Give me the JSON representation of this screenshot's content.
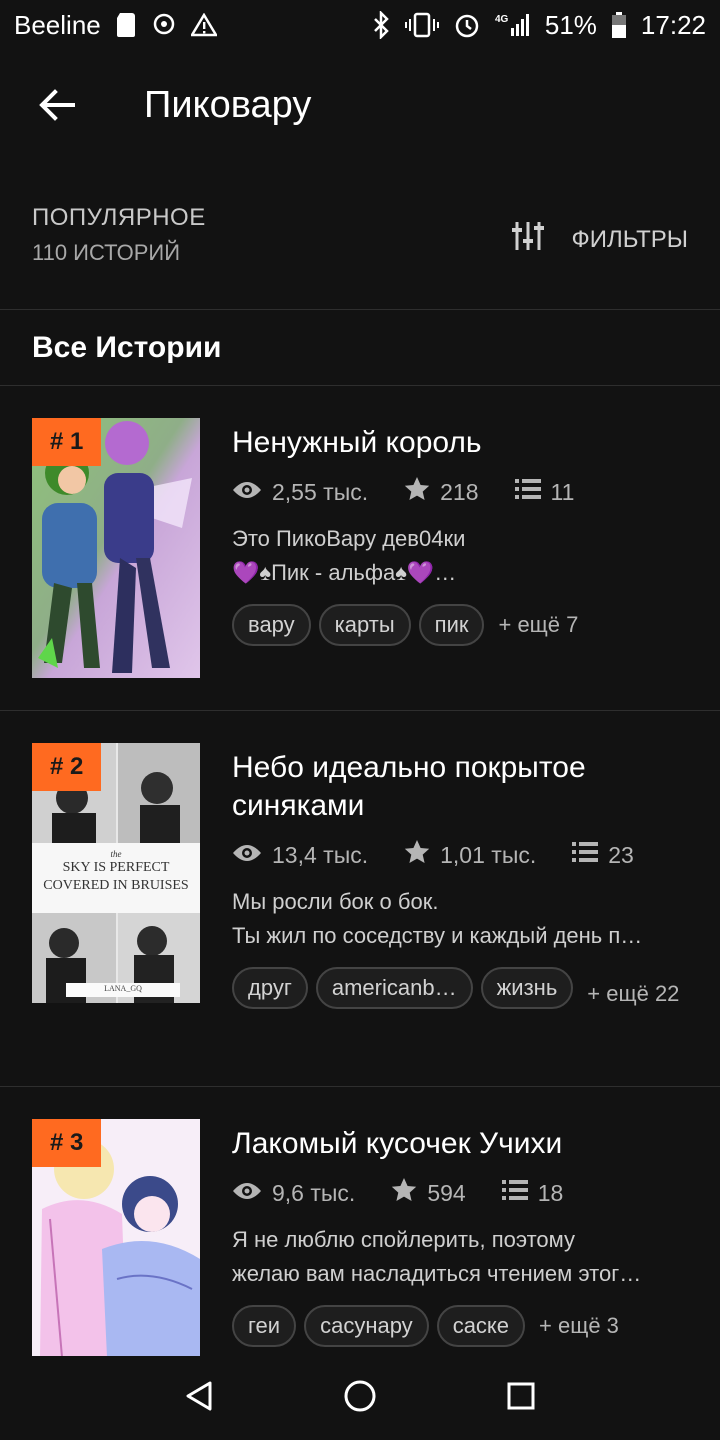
{
  "status_bar": {
    "carrier": "Beeline",
    "battery": "51%",
    "time": "17:22",
    "network": "4G"
  },
  "app_bar": {
    "title": "Пиковару"
  },
  "sort": {
    "label": "ПОПУЛЯРНОЕ",
    "count": "110 ИСТОРИЙ",
    "filters_label": "ФИЛЬТРЫ"
  },
  "section": {
    "title": "Все Истории"
  },
  "colors": {
    "accent": "#ff6a20",
    "background": "#121212"
  },
  "stories": [
    {
      "rank": "# 1",
      "title": "Ненужный король",
      "reads": "2,55 тыс.",
      "votes": "218",
      "parts": "11",
      "desc_line1": "Это ПикоВару дев04ки",
      "desc_line2": "💜♠Пик - альфа♠💜…",
      "tags": [
        "вару",
        "карты",
        "пик"
      ],
      "more": "+ ещё 7"
    },
    {
      "rank": "# 2",
      "title": "Небо идеально покрытое синяками",
      "reads": "13,4 тыс.",
      "votes": "1,01 тыс.",
      "parts": "23",
      "desc_line1": "Мы росли бок о бок.",
      "desc_line2": "Ты жил по соседству и каждый день п…",
      "tags": [
        "друг",
        "americanb…",
        "жизнь"
      ],
      "more": "+ ещё 22",
      "cover_text_top": "the",
      "cover_text": "SKY IS PERFECT COVERED IN BRUISES",
      "cover_author": "LANA_GQ"
    },
    {
      "rank": "# 3",
      "title": "Лакомый кусочек Учихи",
      "reads": "9,6 тыс.",
      "votes": "594",
      "parts": "18",
      "desc_line1": "Я не люблю спойлерить, поэтому",
      "desc_line2": "желаю вам насладиться чтением этог…",
      "tags": [
        "геи",
        "сасунару",
        "саске"
      ],
      "more": "+ ещё 3"
    }
  ]
}
